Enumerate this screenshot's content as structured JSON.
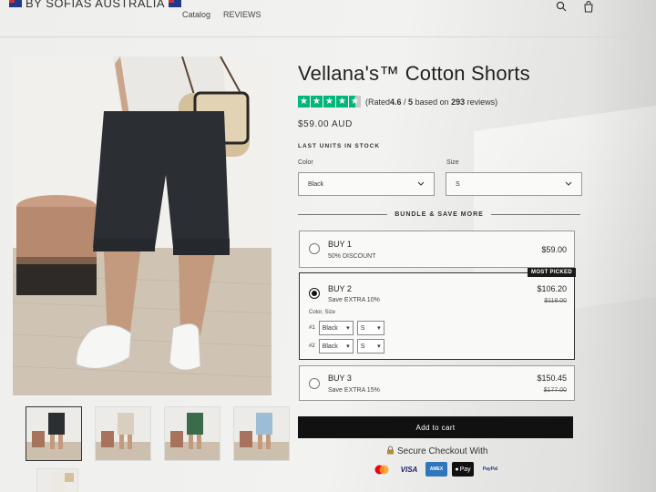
{
  "header": {
    "brand": "BY SOFIAS AUSTRALIA",
    "nav": [
      "Catalog",
      "REVIEWS"
    ],
    "icons": [
      "search-icon",
      "cart-icon"
    ]
  },
  "product": {
    "title": "Vellana's™ Cotton Shorts",
    "rating": {
      "stars_value": 4.6,
      "prefix": "(Rated",
      "value": "4.6",
      "mid": " / ",
      "scale": "5",
      "based": " based on ",
      "count": "293",
      "suffix": " reviews)"
    },
    "price": "$59.00 AUD",
    "stock": "LAST UNITS IN STOCK",
    "color_label": "Color",
    "color_value": "Black",
    "size_label": "Size",
    "size_value": "S"
  },
  "bundle": {
    "heading": "BUNDLE & SAVE MORE",
    "options": [
      {
        "title": "BUY 1",
        "subtitle": "50% DISCOUNT",
        "price": "$59.00",
        "old_price": "",
        "selected": false
      },
      {
        "title": "BUY 2",
        "subtitle": "Save EXTRA 10%",
        "price": "$106.20",
        "old_price": "$118.00",
        "selected": true,
        "badge": "MOST PICKED"
      },
      {
        "title": "BUY 3",
        "subtitle": "Save EXTRA 15%",
        "price": "$150.45",
        "old_price": "$177.00",
        "selected": false
      }
    ],
    "variant_label": "Color, Size",
    "variants": [
      {
        "index": "#1",
        "color": "Black",
        "size": "S"
      },
      {
        "index": "#2",
        "color": "Black",
        "size": "S"
      }
    ]
  },
  "actions": {
    "add_to_cart": "Add to cart",
    "secure_checkout": "Secure Checkout With"
  },
  "payments": [
    "mastercard",
    "VISA",
    "AMEX",
    "Pay",
    "PayPal"
  ],
  "colors": {
    "trustpilot_green": "#00b67a",
    "button_black": "#111111"
  }
}
